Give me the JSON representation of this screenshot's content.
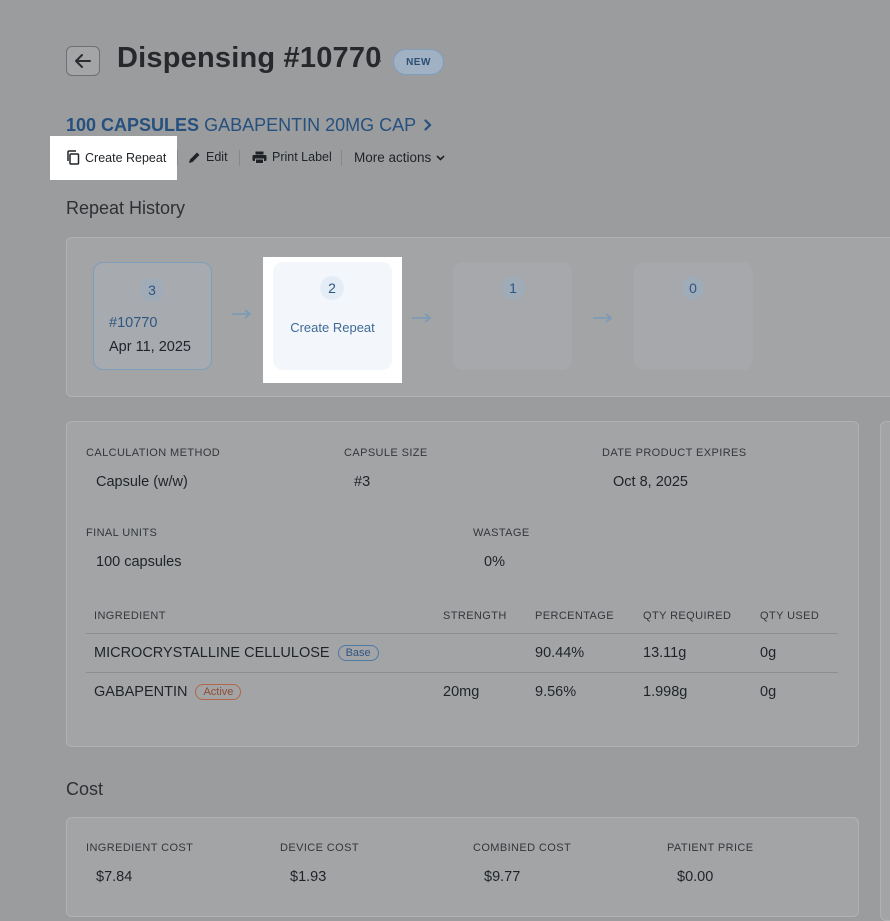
{
  "header": {
    "title": "Dispensing #10770",
    "separator": "·",
    "status_badge": "NEW"
  },
  "product": {
    "quantity": "100 CAPSULES",
    "name": "GABAPENTIN 20MG CAP"
  },
  "toolbar": {
    "create_repeat": "Create Repeat",
    "edit": "Edit",
    "print_label": "Print Label",
    "more_actions": "More actions"
  },
  "repeat_history": {
    "title": "Repeat History",
    "steps": [
      {
        "number": "3",
        "link": "#10770",
        "date": "Apr 11, 2025"
      },
      {
        "number": "2",
        "action": "Create Repeat"
      },
      {
        "number": "1"
      },
      {
        "number": "0"
      }
    ]
  },
  "details": {
    "calculation_method_label": "CALCULATION METHOD",
    "calculation_method": "Capsule (w/w)",
    "capsule_size_label": "CAPSULE SIZE",
    "capsule_size": "#3",
    "expires_label": "DATE PRODUCT EXPIRES",
    "expires": "Oct 8, 2025",
    "final_units_label": "FINAL UNITS",
    "final_units": "100 capsules",
    "wastage_label": "WASTAGE",
    "wastage": "0%"
  },
  "ingredients": {
    "headers": [
      "INGREDIENT",
      "STRENGTH",
      "PERCENTAGE",
      "QTY REQUIRED",
      "QTY USED"
    ],
    "rows": [
      {
        "name": "MICROCRYSTALLINE CELLULOSE",
        "tag": "Base",
        "strength": "",
        "percentage": "90.44%",
        "qty_required": "13.11g",
        "qty_used": "0g"
      },
      {
        "name": "GABAPENTIN",
        "tag": "Active",
        "strength": "20mg",
        "percentage": "9.56%",
        "qty_required": "1.998g",
        "qty_used": "0g"
      }
    ]
  },
  "cost": {
    "title": "Cost",
    "ingredient_cost_label": "INGREDIENT COST",
    "ingredient_cost": "$7.84",
    "device_cost_label": "DEVICE COST",
    "device_cost": "$1.93",
    "combined_cost_label": "COMBINED COST",
    "combined_cost": "$9.77",
    "patient_price_label": "PATIENT PRICE",
    "patient_price": "$0.00"
  },
  "colors": {
    "accent": "#2f5682",
    "active_tag": "#b2664a",
    "overlay": "#9b9c9e",
    "highlight": "#ffffff"
  }
}
